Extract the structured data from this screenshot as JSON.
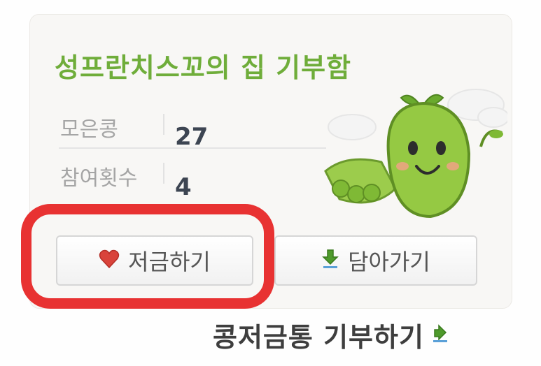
{
  "widget": {
    "title": "성프란치스꼬의 집 기부함",
    "stats": [
      {
        "label": "모은콩",
        "value": "27"
      },
      {
        "label": "참여횟수",
        "value": "4"
      }
    ],
    "buttons": {
      "save_label": "저금하기",
      "bring_label": "담아가기"
    },
    "donate_link": "콩저금통 기부하기"
  },
  "colors": {
    "title_green": "#6fad3a",
    "annotation_red": "#e83232",
    "heart_red": "#d9433b",
    "icon_green": "#4e9a2b"
  },
  "icons": {
    "save": "heart-icon",
    "bring": "download-icon",
    "donate": "link-arrow-icon"
  }
}
